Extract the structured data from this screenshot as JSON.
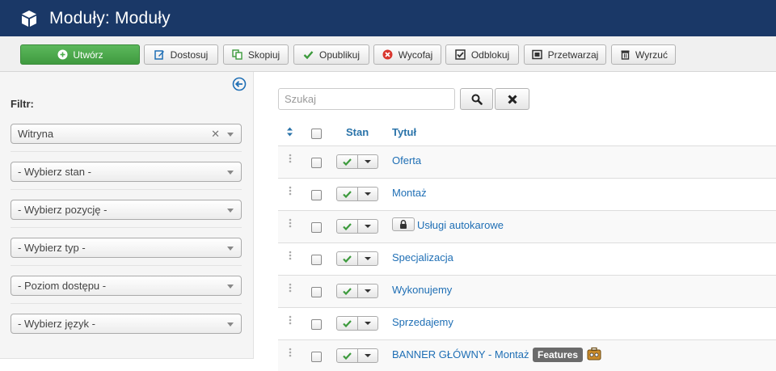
{
  "header": {
    "title": "Moduły: Moduły"
  },
  "toolbar": {
    "buttons": [
      {
        "label": "Utwórz",
        "icon": "plus-circle-icon"
      },
      {
        "label": "Dostosuj",
        "icon": "edit-icon"
      },
      {
        "label": "Skopiuj",
        "icon": "copy-icon"
      },
      {
        "label": "Opublikuj",
        "icon": "check-icon"
      },
      {
        "label": "Wycofaj",
        "icon": "unpublish-icon"
      },
      {
        "label": "Odblokuj",
        "icon": "checkin-icon"
      },
      {
        "label": "Przetwarzaj",
        "icon": "batch-icon"
      },
      {
        "label": "Wyrzuć",
        "icon": "trash-icon"
      }
    ]
  },
  "sidebar": {
    "filter_label": "Filtr:",
    "site_select": "Witryna",
    "filters": [
      "- Wybierz stan -",
      "- Wybierz pozycję -",
      "- Wybierz typ -",
      "- Poziom dostępu -",
      "- Wybierz język -"
    ]
  },
  "search": {
    "placeholder": "Szukaj"
  },
  "table": {
    "columns": {
      "status": "Stan",
      "title": "Tytuł"
    },
    "rows": [
      {
        "title": "Oferta",
        "locked": false
      },
      {
        "title": "Montaż",
        "locked": false
      },
      {
        "title": "Usługi autokarowe",
        "locked": true
      },
      {
        "title": "Specjalizacja",
        "locked": false
      },
      {
        "title": "Wykonujemy",
        "locked": false
      },
      {
        "title": "Sprzedajemy",
        "locked": false
      },
      {
        "title": "BANNER GŁÓWNY - Montaż",
        "locked": false,
        "badge": "Features"
      }
    ]
  },
  "colors": {
    "header_bg": "#1a3867",
    "primary_btn": "#4cae4c",
    "link": "#1f6fb5",
    "check": "#3c9a3c"
  }
}
